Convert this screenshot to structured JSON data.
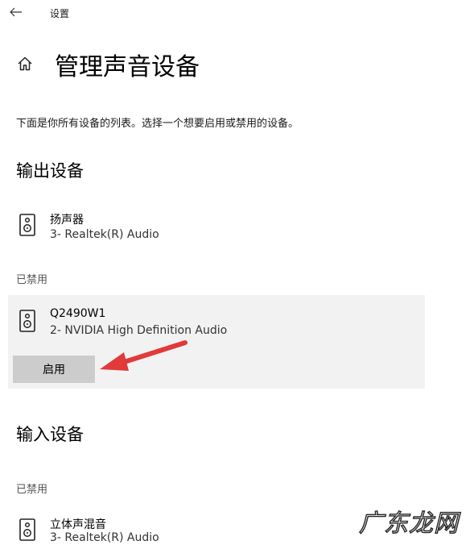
{
  "window": {
    "app_title": "设置",
    "back_icon": "arrow-left-icon"
  },
  "header": {
    "page_title": "管理声音设备",
    "home_icon": "home-icon"
  },
  "description": "下面是你所有设备的列表。选择一个想要启用或禁用的设备。",
  "output": {
    "heading": "输出设备",
    "devices": [
      {
        "name": "扬声器",
        "sub": "3- Realtek(R) Audio",
        "icon": "speaker-icon"
      }
    ],
    "disabled_label": "已禁用",
    "disabled_devices": [
      {
        "name": "Q2490W1",
        "sub": "2- NVIDIA High Definition Audio",
        "icon": "speaker-icon",
        "selected": true,
        "action_label": "启用"
      }
    ]
  },
  "input": {
    "heading": "输入设备",
    "disabled_label": "已禁用",
    "disabled_devices": [
      {
        "name": "立体声混音",
        "sub": "3- Realtek(R) Audio",
        "icon": "speaker-icon"
      }
    ]
  },
  "annotation": {
    "arrow_color": "#e03a3a"
  },
  "watermark": "广东龙网"
}
